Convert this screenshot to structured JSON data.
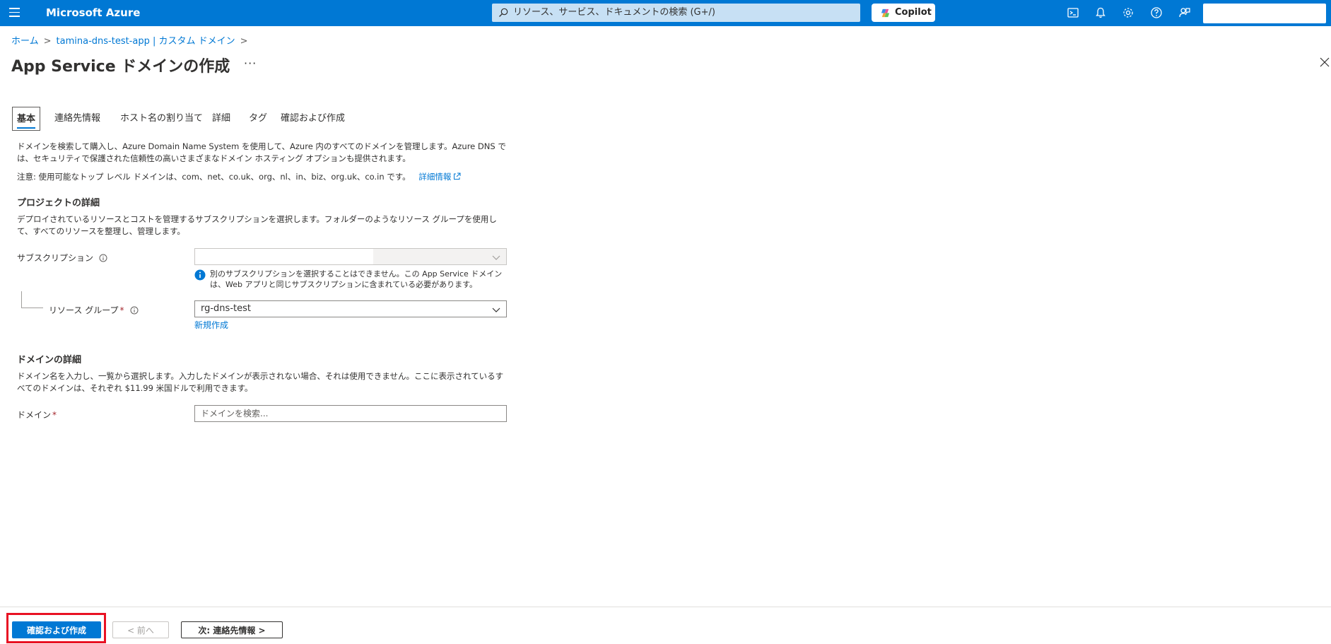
{
  "topbar": {
    "brand": "Microsoft Azure",
    "search_placeholder": "リソース、サービス、ドキュメントの検索 (G+/)",
    "copilot_label": "Copilot",
    "icons": [
      "menu-icon",
      "search-icon",
      "copilot-icon",
      "cloud-shell-icon",
      "bell-icon",
      "gear-icon",
      "help-icon",
      "feedback-icon"
    ],
    "bar_color": "#0078d4"
  },
  "breadcrumb": {
    "items": [
      "ホーム",
      "tamina-dns-test-app | カスタム ドメイン"
    ]
  },
  "page": {
    "title": "App Service ドメインの作成",
    "more": "···"
  },
  "tabs": [
    {
      "label": "基本",
      "active": true
    },
    {
      "label": "連絡先情報",
      "active": false
    },
    {
      "label": "ホスト名の割り当て",
      "active": false
    },
    {
      "label": "詳細",
      "active": false
    },
    {
      "label": "タグ",
      "active": false
    },
    {
      "label": "確認および作成",
      "active": false
    }
  ],
  "intro": {
    "description": "ドメインを検索して購入し、Azure Domain Name System を使用して、Azure 内のすべてのドメインを管理します。Azure DNS では、セキュリティで保護された信頼性の高いさまざまなドメイン ホスティング オプションも提供されます。",
    "note": "注意: 使用可能なトップ レベル ドメインは、com、net、co.uk、org、nl、in、biz、org.uk、co.in です。",
    "learn_more": "詳細情報"
  },
  "project_details": {
    "heading": "プロジェクトの詳細",
    "description": "デプロイされているリソースとコストを管理するサブスクリプションを選択します。フォルダーのようなリソース グループを使用して、すべてのリソースを整理し、管理します。",
    "subscription_label": "サブスクリプション",
    "subscription_value": "",
    "subscription_note": "別のサブスクリプションを選択することはできません。この App Service ドメインは、Web アプリと同じサブスクリプションに含まれている必要があります。",
    "resource_group_label": "リソース グループ",
    "resource_group_value": "rg-dns-test",
    "create_new": "新規作成"
  },
  "domain_details": {
    "heading": "ドメインの詳細",
    "description": "ドメイン名を入力し、一覧から選択します。入力したドメインが表示されない場合、それは使用できません。ここに表示されているすべてのドメインは、それぞれ $11.99 米国ドルで利用できます。",
    "domain_label": "ドメイン",
    "domain_placeholder": "ドメインを検索..."
  },
  "footer": {
    "review_create": "確認および作成",
    "previous": "< 前へ",
    "next": "次: 連絡先情報 >",
    "highlight_color": "#e81123"
  }
}
